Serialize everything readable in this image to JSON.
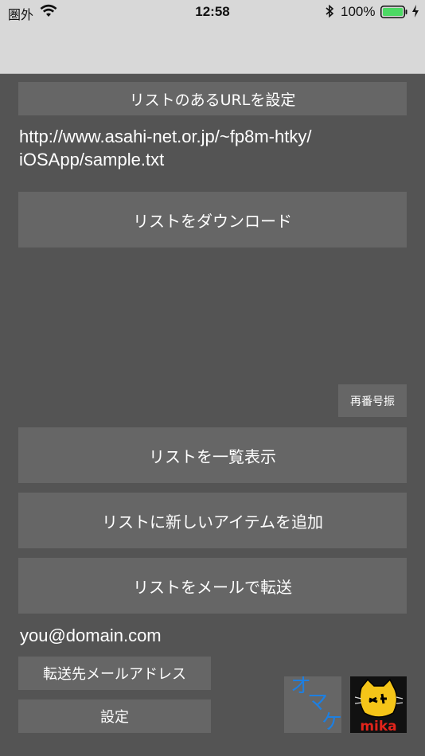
{
  "status_bar": {
    "carrier": "圏外",
    "time": "12:58",
    "battery_percent": "100%",
    "icons": [
      "wifi-icon",
      "bluetooth-icon",
      "battery-icon",
      "charging-bolt-icon"
    ]
  },
  "settings": {
    "set_url_label": "リストのあるURLを設定",
    "url_line1": "http://www.asahi-net.or.jp/~fp8m-htky/",
    "url_line2": "iOSApp/sample.txt",
    "download_label": "リストをダウンロード",
    "renumber_label": "再番号振",
    "show_list_label": "リストを一覧表示",
    "add_item_label": "リストに新しいアイテムを追加",
    "mail_list_label": "リストをメールで転送",
    "email": "you@domain.com",
    "forward_address_label": "転送先メールアドレス",
    "settings_label": "設定"
  },
  "omake": {
    "text": "オマケ",
    "color": "#1e7fe0"
  },
  "mika": {
    "text": "mika",
    "text_color": "#e2241b",
    "face_color": "#f5c518"
  },
  "colors": {
    "background": "#545454",
    "button": "#666666",
    "bar": "#d8d8d8",
    "battery": "#4cd964"
  }
}
